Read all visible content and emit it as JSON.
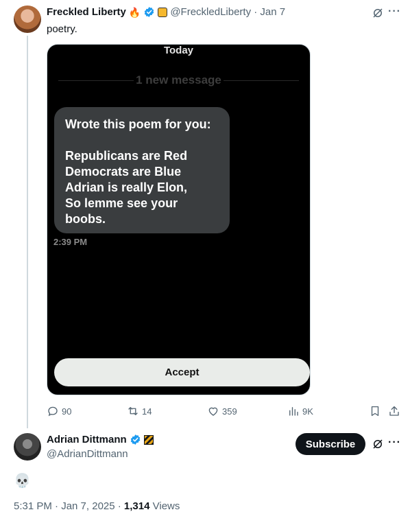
{
  "tweet": {
    "author_name": "Freckled Liberty",
    "author_emoji": "🔥",
    "handle_date": "@FreckledLiberty · Jan 7",
    "text": "poetry.",
    "media": {
      "today_label": "Today",
      "new_message_label": "1 new message",
      "bubble_lines": [
        "Wrote this poem for you:",
        "",
        "Republicans are Red",
        "Democrats are Blue",
        "Adrian is really Elon,",
        "So lemme see your",
        "boobs."
      ],
      "time": "2:39 PM",
      "accept_label": "Accept"
    },
    "stats": {
      "replies": "90",
      "reposts": "14",
      "likes": "359",
      "views": "9K"
    }
  },
  "reply": {
    "author_name": "Adrian Dittmann",
    "handle": "@AdrianDittmann",
    "subscribe_label": "Subscribe",
    "text": "💀",
    "timestamp": "5:31 PM · Jan 7, 2025 · ",
    "views_count": "1,314",
    "views_label": " Views"
  },
  "colors": {
    "verified": "#1d9bf0",
    "text_muted": "#536471",
    "subscribe_bg": "#0f1419"
  },
  "icons": [
    "grok-icon",
    "more-icon",
    "reply-icon",
    "repost-icon",
    "like-icon",
    "views-icon",
    "bookmark-icon",
    "share-icon",
    "verified-icon"
  ]
}
